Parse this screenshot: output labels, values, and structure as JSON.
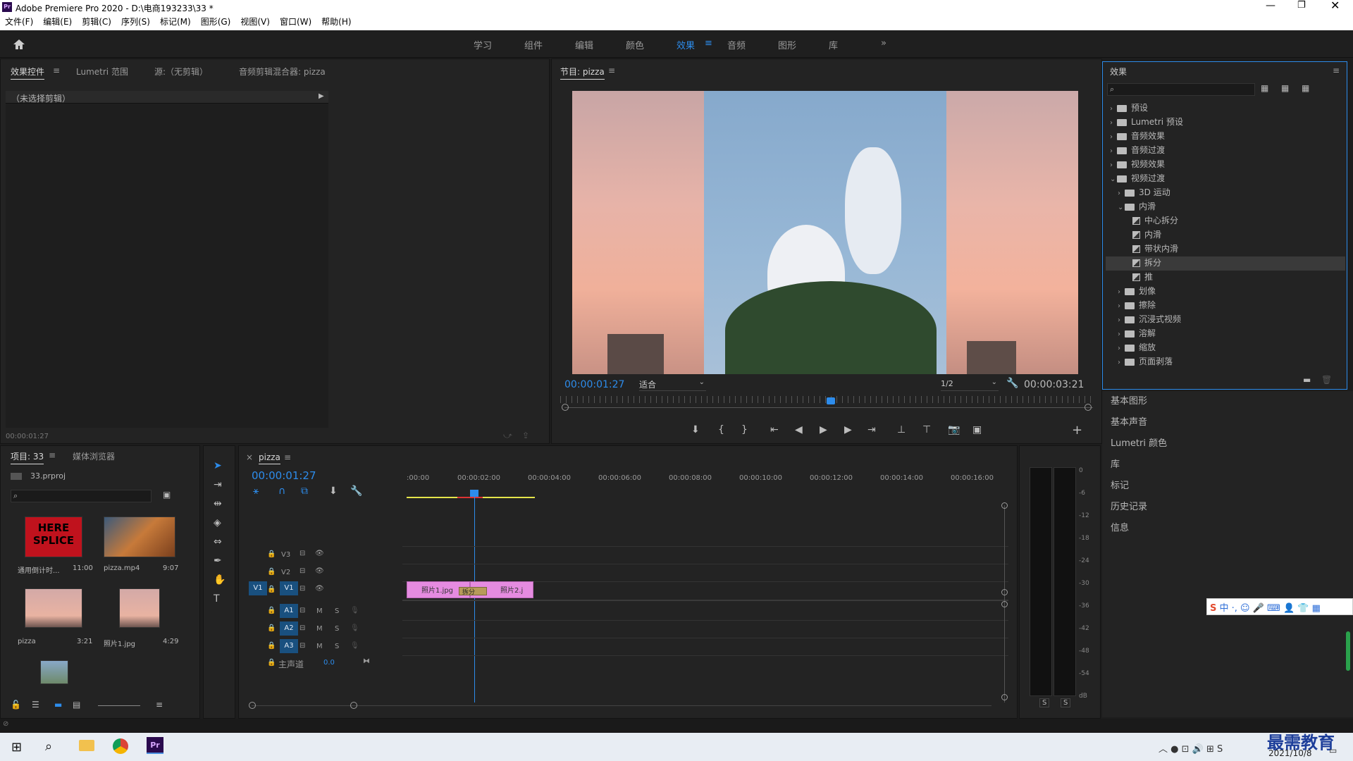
{
  "app": {
    "title": "Adobe Premiere Pro 2020 - D:\\电商193233\\33 *"
  },
  "menu": [
    "文件(F)",
    "编辑(E)",
    "剪辑(C)",
    "序列(S)",
    "标记(M)",
    "图形(G)",
    "视图(V)",
    "窗口(W)",
    "帮助(H)"
  ],
  "workspaces": [
    "学习",
    "组件",
    "编辑",
    "颜色",
    "效果",
    "音频",
    "图形",
    "库"
  ],
  "source_panel": {
    "tabs": [
      "效果控件",
      "Lumetri 范围",
      "源:（无剪辑）",
      "音频剪辑混合器: pizza"
    ],
    "no_clip": "（未选择剪辑）",
    "timecode": "00:00:01:27"
  },
  "program": {
    "title": "节目: pizza",
    "timecode": "00:00:01:27",
    "fit": "适合",
    "quality": "1/2",
    "duration": "00:00:03:21"
  },
  "effects": {
    "title": "效果",
    "tree": [
      {
        "label": "预设",
        "level": 0,
        "icon": "folder-star"
      },
      {
        "label": "Lumetri 预设",
        "level": 0,
        "icon": "folder-star"
      },
      {
        "label": "音频效果",
        "level": 0,
        "icon": "folder"
      },
      {
        "label": "音频过渡",
        "level": 0,
        "icon": "folder"
      },
      {
        "label": "视频效果",
        "level": 0,
        "icon": "folder"
      },
      {
        "label": "视频过渡",
        "level": 0,
        "icon": "folder",
        "open": true
      },
      {
        "label": "3D 运动",
        "level": 1,
        "icon": "folder"
      },
      {
        "label": "内滑",
        "level": 1,
        "icon": "folder",
        "open": true
      },
      {
        "label": "中心拆分",
        "level": 2,
        "icon": "effect"
      },
      {
        "label": "内滑",
        "level": 2,
        "icon": "effect"
      },
      {
        "label": "带状内滑",
        "level": 2,
        "icon": "effect"
      },
      {
        "label": "拆分",
        "level": 2,
        "icon": "effect",
        "selected": true
      },
      {
        "label": "推",
        "level": 2,
        "icon": "effect"
      },
      {
        "label": "划像",
        "level": 1,
        "icon": "folder"
      },
      {
        "label": "擦除",
        "level": 1,
        "icon": "folder"
      },
      {
        "label": "沉浸式视频",
        "level": 1,
        "icon": "folder"
      },
      {
        "label": "溶解",
        "level": 1,
        "icon": "folder"
      },
      {
        "label": "缩放",
        "level": 1,
        "icon": "folder"
      },
      {
        "label": "页面剥落",
        "level": 1,
        "icon": "folder"
      }
    ]
  },
  "side_panels": [
    "基本图形",
    "基本声音",
    "Lumetri 颜色",
    "库",
    "标记",
    "历史记录",
    "信息"
  ],
  "project": {
    "tabs": [
      "项目: 33",
      "媒体浏览器"
    ],
    "file": "33.prproj",
    "items": [
      {
        "name": "通用倒计时...",
        "dur": "11:00"
      },
      {
        "name": "pizza.mp4",
        "dur": "9:07"
      },
      {
        "name": "pizza",
        "dur": "3:21"
      },
      {
        "name": "照片1.jpg",
        "dur": "4:29"
      }
    ]
  },
  "timeline": {
    "tab": "pizza",
    "timecode": "00:00:01:27",
    "ruler": [
      ":00:00",
      "00:00:02:00",
      "00:00:04:00",
      "00:00:06:00",
      "00:00:08:00",
      "00:00:10:00",
      "00:00:12:00",
      "00:00:14:00",
      "00:00:16:00"
    ],
    "video_tracks": [
      "V3",
      "V2",
      "V1"
    ],
    "audio_tracks": [
      "A1",
      "A2",
      "A3"
    ],
    "master": "主声道",
    "master_val": "0.0",
    "source_patch": "V1",
    "clips": {
      "c1": "照片1.jpg",
      "trans": "拆分",
      "c2": "照片2.j"
    }
  },
  "meter": {
    "scale": [
      "0",
      "-6",
      "-12",
      "-18",
      "-24",
      "-30",
      "-36",
      "-42",
      "-48",
      "-54",
      "dB"
    ],
    "solo": [
      "S",
      "S"
    ]
  },
  "watermark": "最需教育",
  "clock": {
    "date": "2021/10/8"
  },
  "colors": {
    "accent": "#2d8ceb",
    "clip": "#e58be0",
    "playhead": "#2d8ceb"
  }
}
